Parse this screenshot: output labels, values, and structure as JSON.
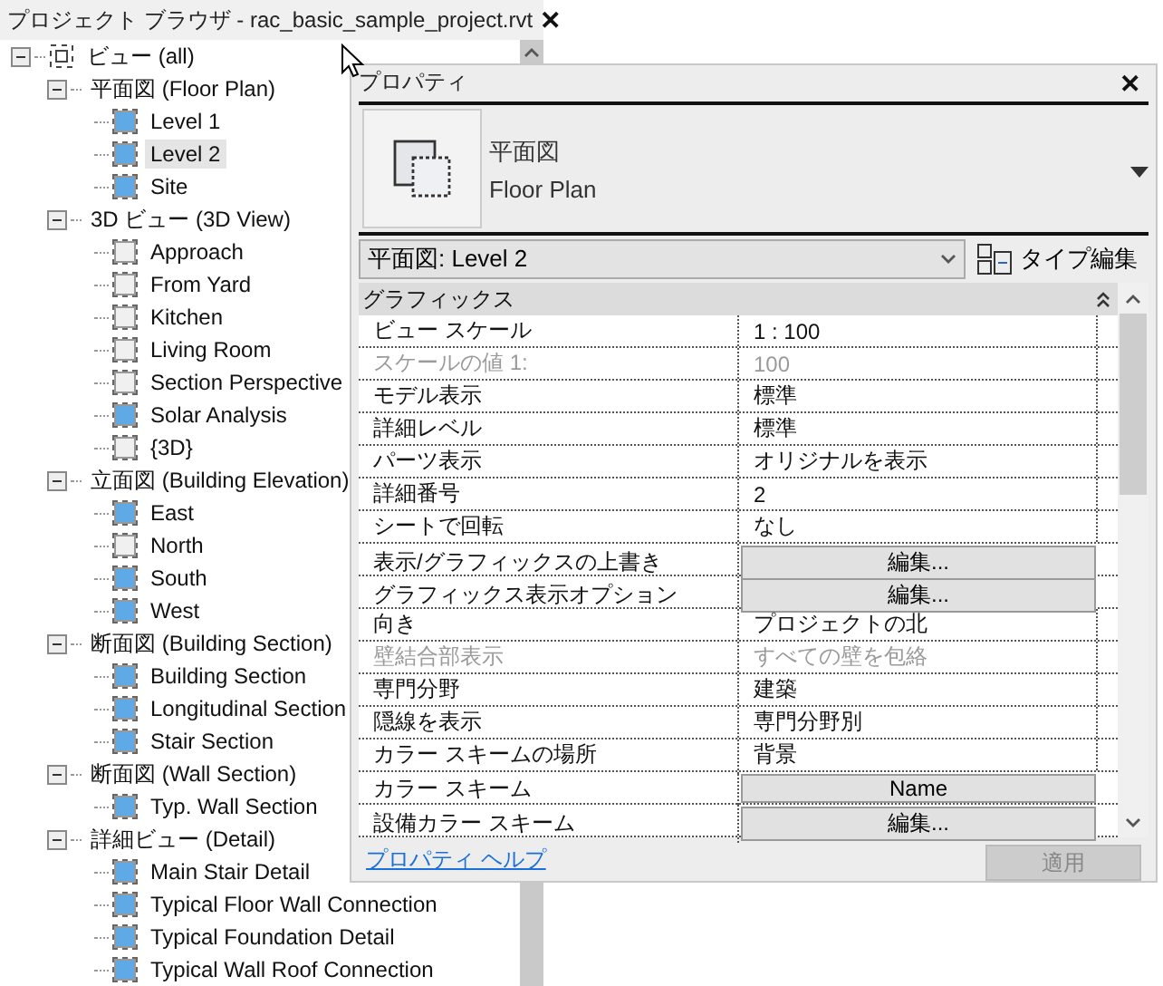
{
  "browser": {
    "title": "プロジェクト ブラウザ - rac_basic_sample_project.rvt",
    "close": "✕",
    "tree": {
      "label": "ビュー (all)",
      "expanded": true,
      "children": [
        {
          "label": "平面図 (Floor Plan)",
          "expanded": true,
          "children": [
            {
              "label": "Level 1",
              "on_sheet": true,
              "selected": false
            },
            {
              "label": "Level 2",
              "on_sheet": true,
              "selected": true
            },
            {
              "label": "Site",
              "on_sheet": true,
              "selected": false
            }
          ]
        },
        {
          "label": "3D ビュー (3D View)",
          "expanded": true,
          "children": [
            {
              "label": "Approach",
              "on_sheet": false,
              "selected": false
            },
            {
              "label": "From Yard",
              "on_sheet": false,
              "selected": false
            },
            {
              "label": "Kitchen",
              "on_sheet": false,
              "selected": false
            },
            {
              "label": "Living Room",
              "on_sheet": false,
              "selected": false
            },
            {
              "label": "Section Perspective",
              "on_sheet": false,
              "selected": false
            },
            {
              "label": "Solar Analysis",
              "on_sheet": true,
              "selected": false
            },
            {
              "label": "{3D}",
              "on_sheet": false,
              "selected": false
            }
          ]
        },
        {
          "label": "立面図 (Building Elevation)",
          "expanded": true,
          "children": [
            {
              "label": "East",
              "on_sheet": true,
              "selected": false
            },
            {
              "label": "North",
              "on_sheet": false,
              "selected": false
            },
            {
              "label": "South",
              "on_sheet": true,
              "selected": false
            },
            {
              "label": "West",
              "on_sheet": true,
              "selected": false
            }
          ]
        },
        {
          "label": "断面図 (Building Section)",
          "expanded": true,
          "children": [
            {
              "label": "Building Section",
              "on_sheet": true,
              "selected": false
            },
            {
              "label": "Longitudinal Section",
              "on_sheet": true,
              "selected": false
            },
            {
              "label": "Stair Section",
              "on_sheet": true,
              "selected": false
            }
          ]
        },
        {
          "label": "断面図 (Wall Section)",
          "expanded": true,
          "children": [
            {
              "label": "Typ. Wall Section",
              "on_sheet": true,
              "selected": false
            }
          ]
        },
        {
          "label": "詳細ビュー (Detail)",
          "expanded": true,
          "children": [
            {
              "label": "Main Stair Detail",
              "on_sheet": true,
              "selected": false
            },
            {
              "label": "Typical Floor Wall Connection",
              "on_sheet": true,
              "selected": false
            },
            {
              "label": "Typical Foundation Detail",
              "on_sheet": true,
              "selected": false
            },
            {
              "label": "Typical Wall Roof Connection",
              "on_sheet": true,
              "selected": false
            }
          ]
        }
      ]
    }
  },
  "properties": {
    "title": "プロパティ",
    "close": "✕",
    "type_name": "平面図",
    "type_name_en": "Floor Plan",
    "instance_selector": "平面図: Level 2",
    "type_edit": "タイプ編集",
    "group": {
      "label": "グラフィックス",
      "expanded": true
    },
    "rows": [
      {
        "name": "ビュー スケール",
        "value": "1 : 100",
        "kind": "text",
        "disabled": false
      },
      {
        "name": "スケールの値    1:",
        "value": "100",
        "kind": "text",
        "disabled": true
      },
      {
        "name": "モデル表示",
        "value": "標準",
        "kind": "text",
        "disabled": false
      },
      {
        "name": "詳細レベル",
        "value": "標準",
        "kind": "text",
        "disabled": false
      },
      {
        "name": "パーツ表示",
        "value": "オリジナルを表示",
        "kind": "text",
        "disabled": false
      },
      {
        "name": "詳細番号",
        "value": "2",
        "kind": "text",
        "disabled": false
      },
      {
        "name": "シートで回転",
        "value": "なし",
        "kind": "text",
        "disabled": false
      },
      {
        "name": "表示/グラフィックスの上書き",
        "value": "編集...",
        "kind": "button",
        "disabled": false
      },
      {
        "name": "グラフィックス表示オプション",
        "value": "編集...",
        "kind": "button",
        "disabled": false
      },
      {
        "name": "向き",
        "value": "プロジェクトの北",
        "kind": "text",
        "disabled": false
      },
      {
        "name": "壁結合部表示",
        "value": "すべての壁を包絡",
        "kind": "text",
        "disabled": true
      },
      {
        "name": "専門分野",
        "value": "建築",
        "kind": "text",
        "disabled": false
      },
      {
        "name": "隠線を表示",
        "value": "専門分野別",
        "kind": "text",
        "disabled": false
      },
      {
        "name": "カラー スキームの場所",
        "value": "背景",
        "kind": "text",
        "disabled": false
      },
      {
        "name": "カラー スキーム",
        "value": "Name",
        "kind": "button",
        "disabled": false
      },
      {
        "name": "設備カラー スキーム",
        "value": "編集...",
        "kind": "button",
        "disabled": false
      }
    ],
    "help_link": "プロパティ ヘルプ",
    "apply": {
      "label": "適用",
      "disabled": true
    }
  }
}
